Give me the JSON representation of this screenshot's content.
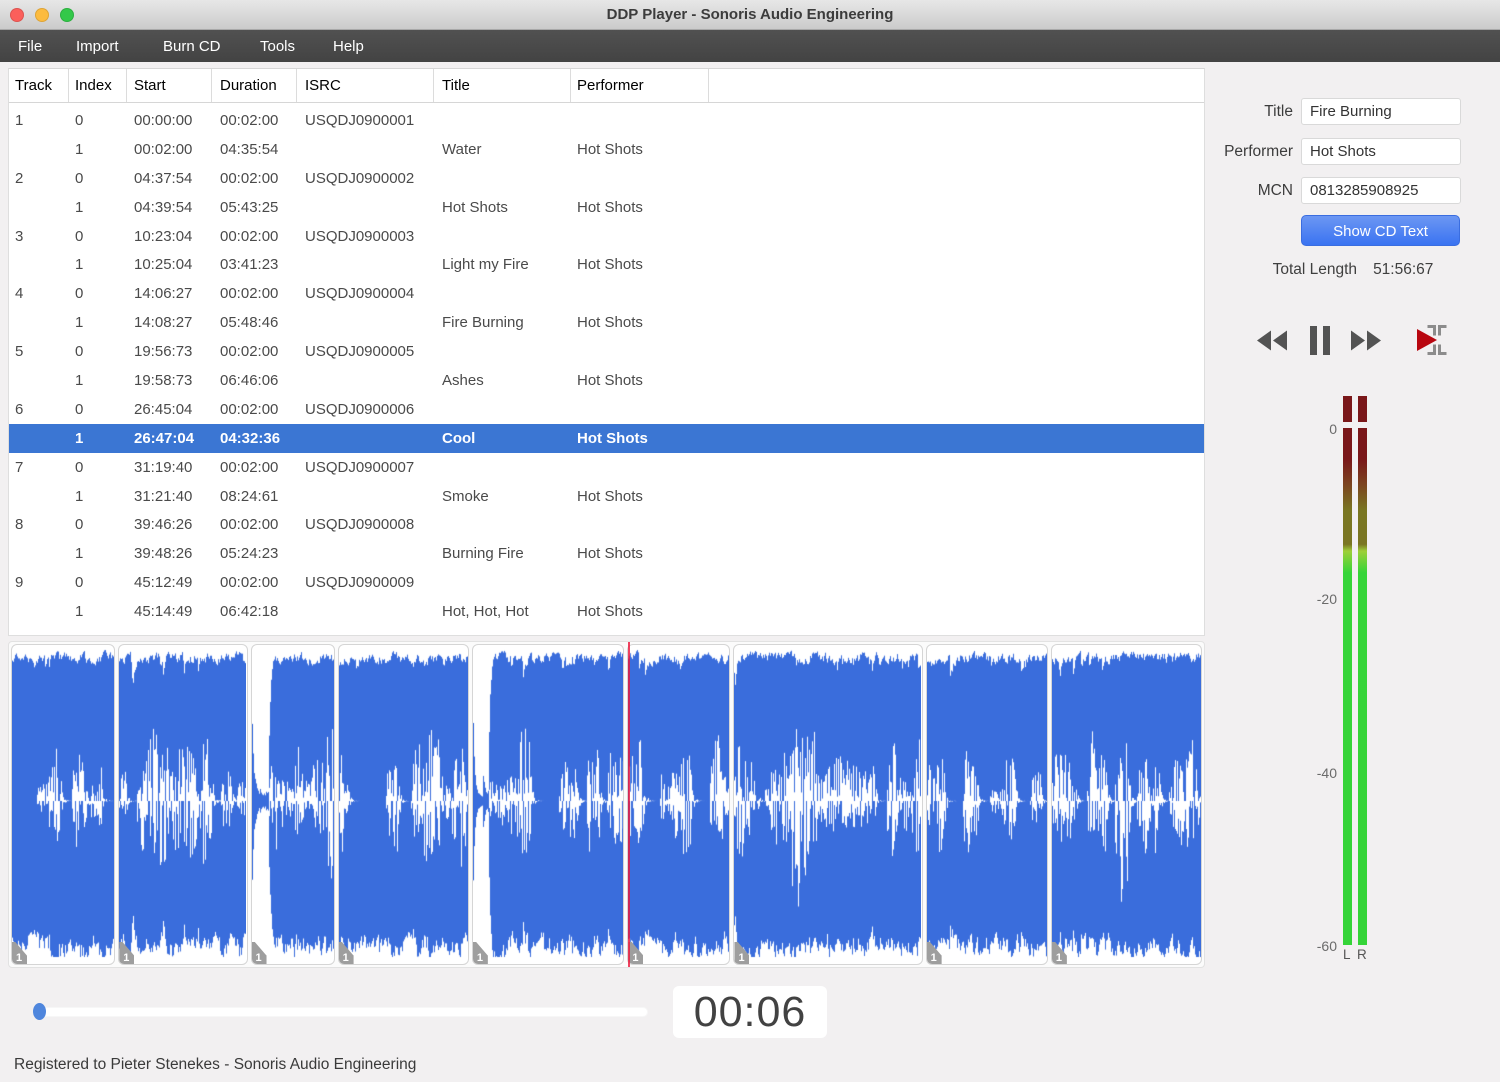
{
  "window": {
    "title": "DDP Player - Sonoris Audio Engineering"
  },
  "menu": {
    "items": [
      "File",
      "Import",
      "Burn CD",
      "Tools",
      "Help"
    ]
  },
  "table": {
    "columns": [
      "Track",
      "Index",
      "Start",
      "Duration",
      "ISRC",
      "Title",
      "Performer"
    ],
    "rows": [
      {
        "track": "1",
        "index": "0",
        "start": "00:00:00",
        "duration": "00:02:00",
        "isrc": "USQDJ0900001",
        "title": "",
        "performer": "",
        "selected": false
      },
      {
        "track": "",
        "index": "1",
        "start": "00:02:00",
        "duration": "04:35:54",
        "isrc": "",
        "title": "Water",
        "performer": "Hot Shots",
        "selected": false
      },
      {
        "track": "2",
        "index": "0",
        "start": "04:37:54",
        "duration": "00:02:00",
        "isrc": "USQDJ0900002",
        "title": "",
        "performer": "",
        "selected": false
      },
      {
        "track": "",
        "index": "1",
        "start": "04:39:54",
        "duration": "05:43:25",
        "isrc": "",
        "title": "Hot Shots",
        "performer": "Hot Shots",
        "selected": false
      },
      {
        "track": "3",
        "index": "0",
        "start": "10:23:04",
        "duration": "00:02:00",
        "isrc": "USQDJ0900003",
        "title": "",
        "performer": "",
        "selected": false
      },
      {
        "track": "",
        "index": "1",
        "start": "10:25:04",
        "duration": "03:41:23",
        "isrc": "",
        "title": "Light my Fire",
        "performer": "Hot Shots",
        "selected": false
      },
      {
        "track": "4",
        "index": "0",
        "start": "14:06:27",
        "duration": "00:02:00",
        "isrc": "USQDJ0900004",
        "title": "",
        "performer": "",
        "selected": false
      },
      {
        "track": "",
        "index": "1",
        "start": "14:08:27",
        "duration": "05:48:46",
        "isrc": "",
        "title": "Fire Burning",
        "performer": "Hot Shots",
        "selected": false
      },
      {
        "track": "5",
        "index": "0",
        "start": "19:56:73",
        "duration": "00:02:00",
        "isrc": "USQDJ0900005",
        "title": "",
        "performer": "",
        "selected": false
      },
      {
        "track": "",
        "index": "1",
        "start": "19:58:73",
        "duration": "06:46:06",
        "isrc": "",
        "title": "Ashes",
        "performer": "Hot Shots",
        "selected": false
      },
      {
        "track": "6",
        "index": "0",
        "start": "26:45:04",
        "duration": "00:02:00",
        "isrc": "USQDJ0900006",
        "title": "",
        "performer": "",
        "selected": false
      },
      {
        "track": "",
        "index": "1",
        "start": "26:47:04",
        "duration": "04:32:36",
        "isrc": "",
        "title": "Cool",
        "performer": "Hot Shots",
        "selected": true
      },
      {
        "track": "7",
        "index": "0",
        "start": "31:19:40",
        "duration": "00:02:00",
        "isrc": "USQDJ0900007",
        "title": "",
        "performer": "",
        "selected": false
      },
      {
        "track": "",
        "index": "1",
        "start": "31:21:40",
        "duration": "08:24:61",
        "isrc": "",
        "title": "Smoke",
        "performer": "Hot Shots",
        "selected": false
      },
      {
        "track": "8",
        "index": "0",
        "start": "39:46:26",
        "duration": "00:02:00",
        "isrc": "USQDJ0900008",
        "title": "",
        "performer": "",
        "selected": false
      },
      {
        "track": "",
        "index": "1",
        "start": "39:48:26",
        "duration": "05:24:23",
        "isrc": "",
        "title": "Burning Fire",
        "performer": "Hot Shots",
        "selected": false
      },
      {
        "track": "9",
        "index": "0",
        "start": "45:12:49",
        "duration": "00:02:00",
        "isrc": "USQDJ0900009",
        "title": "",
        "performer": "",
        "selected": false
      },
      {
        "track": "",
        "index": "1",
        "start": "45:14:49",
        "duration": "06:42:18",
        "isrc": "",
        "title": "Hot, Hot, Hot",
        "performer": "Hot Shots",
        "selected": false
      }
    ]
  },
  "cdtext": {
    "title_label": "Title",
    "title_value": "Fire Burning",
    "performer_label": "Performer",
    "performer_value": "Hot Shots",
    "mcn_label": "MCN",
    "mcn_value": "0813285908925",
    "show_button": "Show CD Text",
    "total_length_label": "Total Length",
    "total_length_value": "51:56:67"
  },
  "transport": {
    "icons": [
      "rewind-icon",
      "pause-icon",
      "fast-forward-icon",
      "play-section-icon"
    ]
  },
  "meter": {
    "scale_labels": [
      "0",
      "-20",
      "-40",
      "-60"
    ],
    "channel_labels": [
      "L",
      "R"
    ]
  },
  "player": {
    "time": "00:06"
  },
  "waveform": {
    "tag_label": "1"
  },
  "footer": {
    "text": "Registered to Pieter Stenekes - Sonoris Audio Engineering"
  },
  "colors": {
    "selection_blue": "#3b76d3",
    "waveform_blue": "#3a6ddc",
    "playhead_red": "#eb193c",
    "button_blue_top": "#6c97f3",
    "button_blue_bottom": "#3a73f1",
    "meter_red": "#7a171a",
    "meter_olive": "#7a7722",
    "meter_green": "#36d539",
    "menubar_gray": "#464646",
    "slider_handle_blue": "#4f86dd"
  }
}
